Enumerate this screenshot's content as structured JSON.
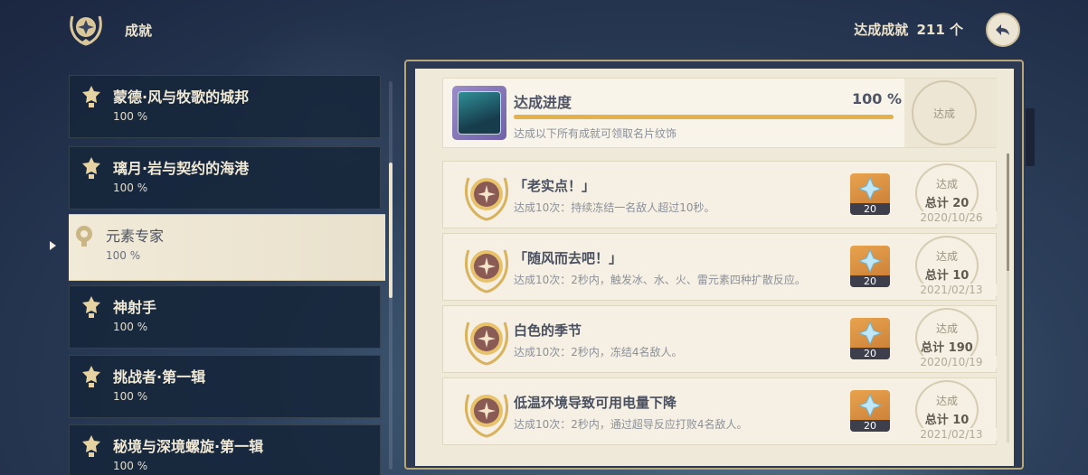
{
  "header": {
    "title": "成就",
    "count_label": "达成成就",
    "count_value": "211 个"
  },
  "categories": [
    {
      "name": "蒙德·风与牧歌的城邦",
      "pct": "100 %"
    },
    {
      "name": "璃月·岩与契约的海港",
      "pct": "100 %"
    },
    {
      "name": "元素专家",
      "pct": "100 %",
      "selected": true
    },
    {
      "name": "神射手",
      "pct": "100 %"
    },
    {
      "name": "挑战者·第一辑",
      "pct": "100 %"
    },
    {
      "name": "秘境与深境螺旋·第一辑",
      "pct": "100 %"
    }
  ],
  "progress": {
    "title": "达成进度",
    "percent_text": "100 %",
    "fraction": 1.0,
    "description": "达成以下所有成就可领取名片纹饰",
    "status": "达成"
  },
  "achievements": [
    {
      "title": "「老实点！」",
      "desc": "达成10次：持续冻结一名敌人超过10秒。",
      "reward_qty": "20",
      "done": "达成",
      "total": "总计 20",
      "date": "2020/10/26"
    },
    {
      "title": "「随风而去吧！」",
      "desc": "达成10次：2秒内，触发冰、水、火、雷元素四种扩散反应。",
      "reward_qty": "20",
      "done": "达成",
      "total": "总计 10",
      "date": "2021/02/13"
    },
    {
      "title": "白色的季节",
      "desc": "达成10次：2秒内，冻结4名敌人。",
      "reward_qty": "20",
      "done": "达成",
      "total": "总计 190",
      "date": "2020/10/19"
    },
    {
      "title": "低温环境导致可用电量下降",
      "desc": "达成10次：2秒内，通过超导反应打败4名敌人。",
      "reward_qty": "20",
      "done": "达成",
      "total": "总计 10",
      "date": "2021/02/13"
    }
  ],
  "colors": {
    "accent_gold": "#e4b24a",
    "panel_bg": "#efe9da",
    "list_bg": "#16263a"
  }
}
